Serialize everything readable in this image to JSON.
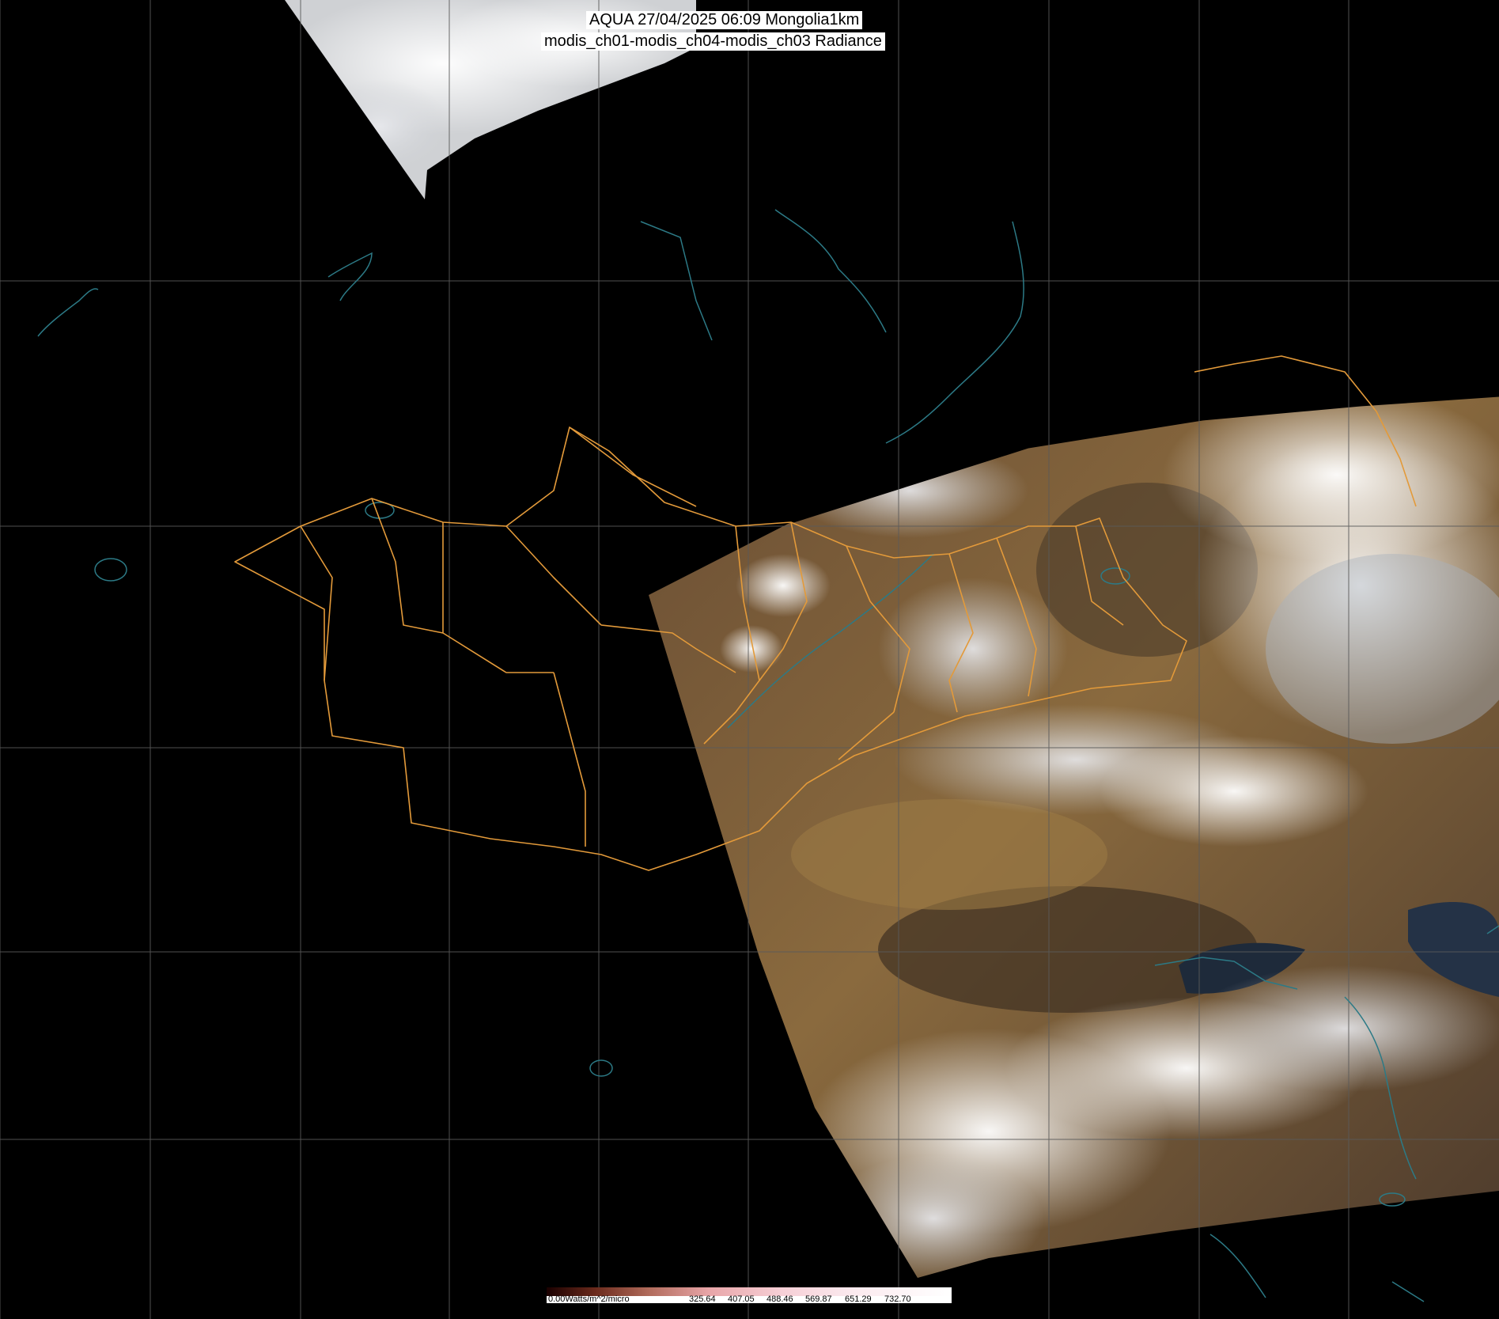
{
  "header": {
    "line1": "AQUA 27/04/2025 06:09 Mongolia1km",
    "line2": "modis_ch01-modis_ch04-modis_ch03 Radiance"
  },
  "colorbar": {
    "unit_label": "0.00Watts/m^2/micro",
    "ticks": [
      "325.64",
      "407.05",
      "488.46",
      "569.87",
      "651.29",
      "732.70"
    ]
  },
  "colors": {
    "background": "#000000",
    "grid": "#5a5a5a",
    "admin_border": "#e39a3a",
    "coastline": "#2c7a86",
    "land": "#7a5a38",
    "cloud": "#e8e8ea"
  }
}
